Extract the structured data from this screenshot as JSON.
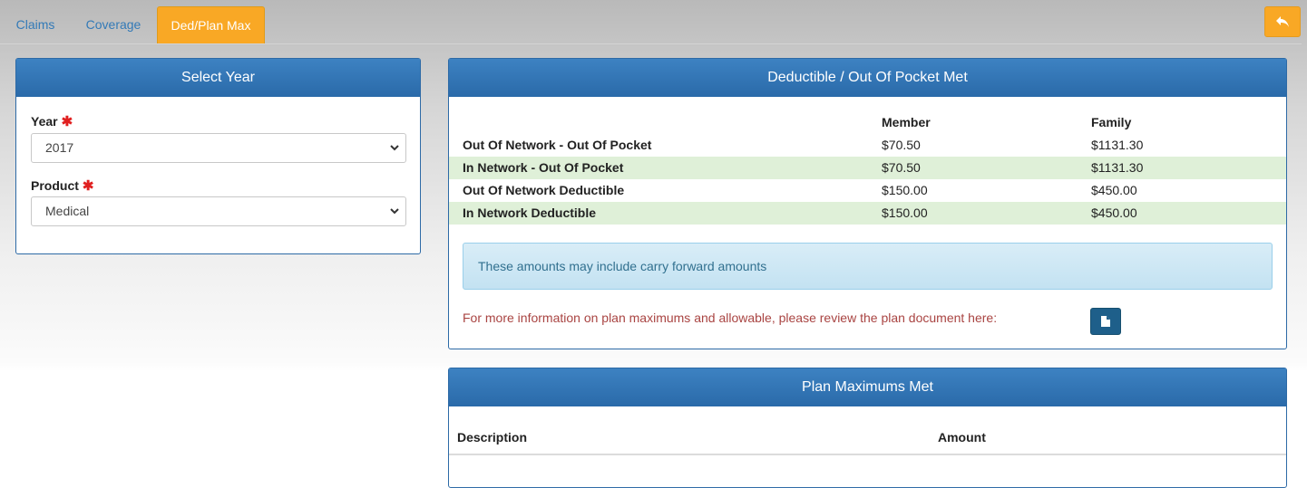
{
  "tabs": [
    {
      "label": "Claims"
    },
    {
      "label": "Coverage"
    },
    {
      "label": "Ded/Plan Max"
    }
  ],
  "icons": {
    "back": "reply-arrow-icon",
    "document": "file-icon",
    "dropdown": "chevron-down-icon",
    "required": "asterisk-icon"
  },
  "colors": {
    "accent": "#f9a825",
    "panel_header": "#2d6aa6",
    "highlight_row": "#dff0d8",
    "info_text": "#31708f",
    "notice_text": "#a94442"
  },
  "select_year": {
    "title": "Select Year",
    "year_label": "Year",
    "year_value": "2017",
    "product_label": "Product",
    "product_value": "Medical",
    "required_mark": "✱"
  },
  "deductible": {
    "title": "Deductible / Out Of Pocket Met",
    "col_member": "Member",
    "col_family": "Family",
    "rows": [
      {
        "desc": "Out Of Network - Out Of Pocket",
        "member": "$70.50",
        "family": "$1131.30"
      },
      {
        "desc": "In Network - Out Of Pocket",
        "member": "$70.50",
        "family": "$1131.30"
      },
      {
        "desc": "Out Of Network Deductible",
        "member": "$150.00",
        "family": "$450.00"
      },
      {
        "desc": "In Network Deductible",
        "member": "$150.00",
        "family": "$450.00"
      }
    ],
    "info": "These amounts may include carry forward amounts",
    "more_info": "For more information on plan maximums and allowable, please review the plan document here:"
  },
  "plan_max": {
    "title": "Plan Maximums Met",
    "col_description": "Description",
    "col_amount": "Amount"
  }
}
